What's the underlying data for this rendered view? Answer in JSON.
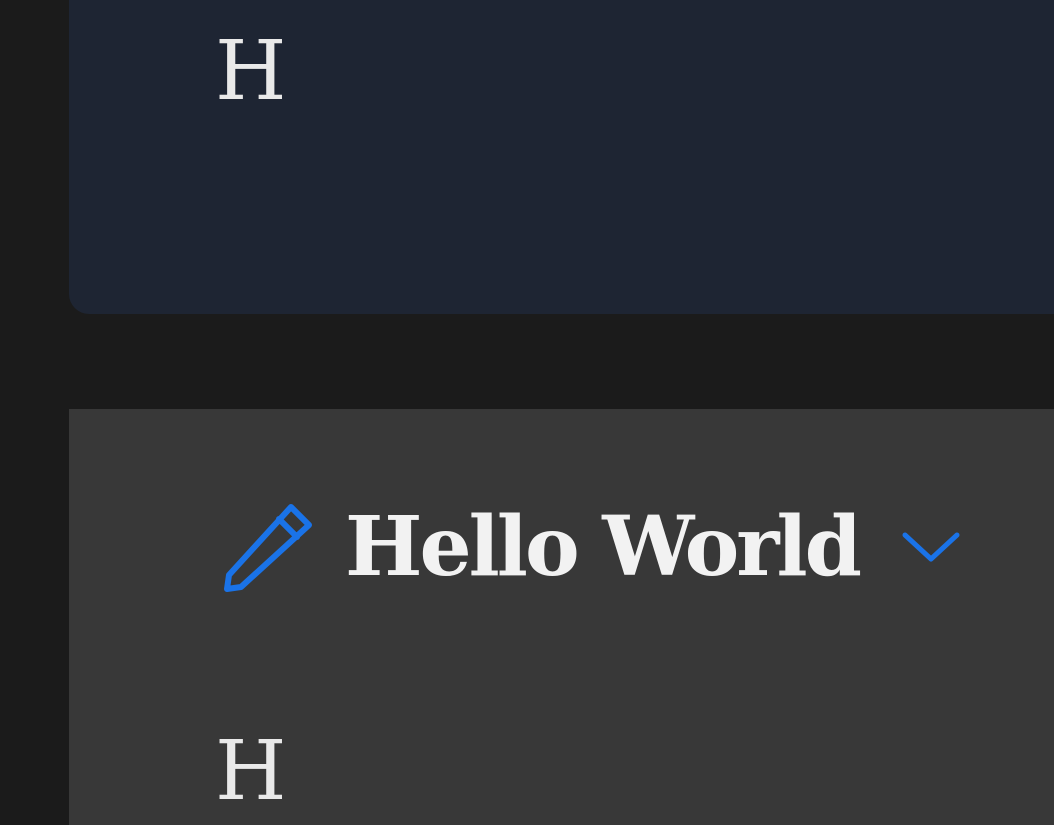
{
  "top_card": {
    "initial": "H",
    "background": "#1e2533"
  },
  "bottom_card": {
    "title": "Hello World",
    "initial": "H",
    "background": "#383838",
    "edit_icon": "pencil-icon",
    "dropdown_icon": "chevron-down-icon"
  },
  "colors": {
    "page_background": "#1b1b1b",
    "accent": "#1a73e8",
    "text": "#f2f2f2"
  }
}
